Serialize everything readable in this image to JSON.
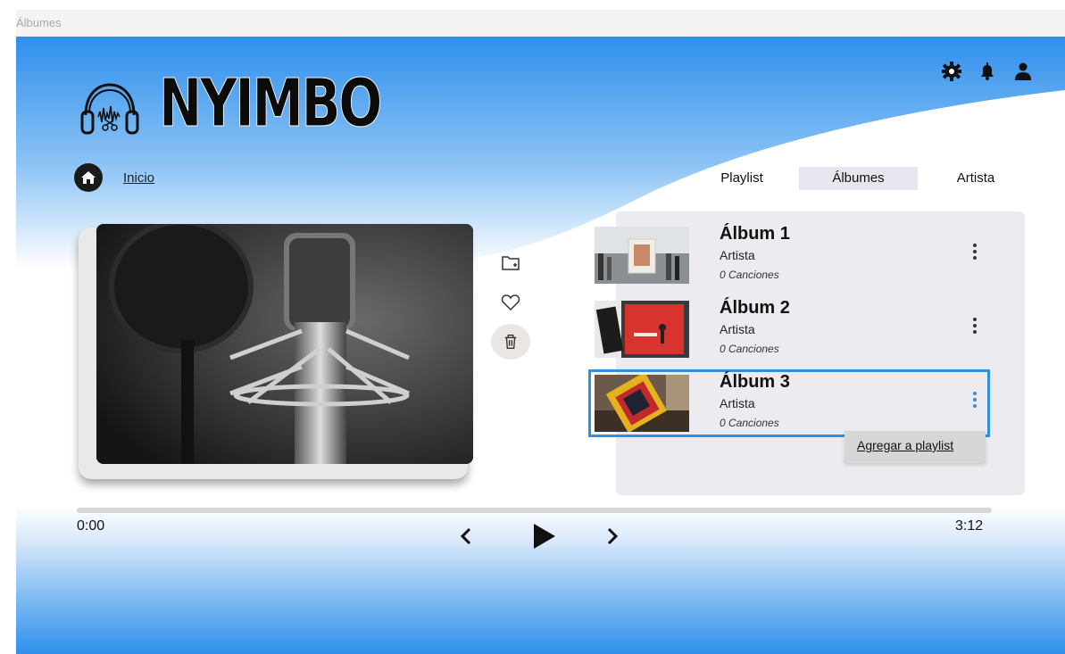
{
  "window": {
    "title": "Álbumes"
  },
  "brand": {
    "name": "NYIMBO"
  },
  "header_icons": [
    "gear-icon",
    "bell-icon",
    "user-icon"
  ],
  "breadcrumb": {
    "home_icon": "home-icon",
    "label": "Inicio"
  },
  "tabs": [
    {
      "label": "Playlist",
      "active": false
    },
    {
      "label": "Álbumes",
      "active": true
    },
    {
      "label": "Artista",
      "active": false
    }
  ],
  "actions": [
    "add-folder-icon",
    "heart-icon",
    "trash-icon"
  ],
  "albums": [
    {
      "title": "Álbum 1",
      "artist": "Artista",
      "songs": "0 Canciones",
      "selected": false
    },
    {
      "title": "Álbum 2",
      "artist": "Artista",
      "songs": "0 Canciones",
      "selected": false
    },
    {
      "title": "Álbum 3",
      "artist": "Artista",
      "songs": "0 Canciones",
      "selected": true
    }
  ],
  "context_menu": {
    "item": "Agregar a playlist"
  },
  "player": {
    "current_time": "0:00",
    "total_time": "3:12",
    "progress": 0
  },
  "colors": {
    "accent": "#2f8fe0",
    "gradient_blue": "#2f8fec",
    "panel": "#ebebf0"
  }
}
